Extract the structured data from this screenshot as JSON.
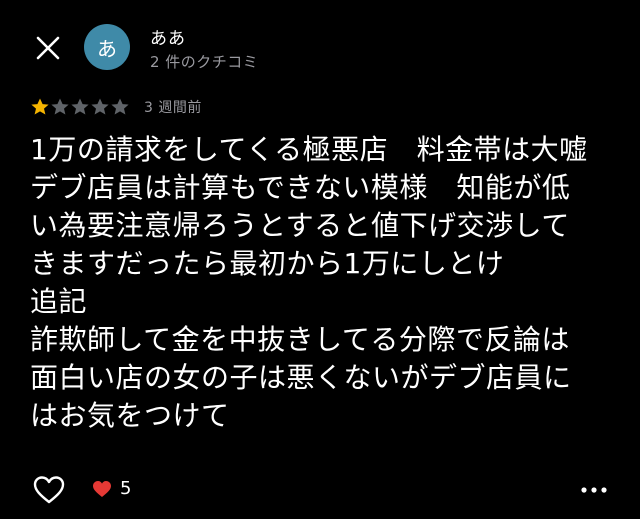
{
  "author": {
    "name": "ああ",
    "avatar_initial": "あ",
    "meta": "2 件のクチコミ",
    "avatar_color": "#3f8aa8"
  },
  "rating": {
    "value": 1,
    "max": 5,
    "star_color": "#f5b400",
    "empty_star_color": "#5f6368",
    "time": "3 週間前"
  },
  "review": {
    "text": "1万の請求をしてくる極悪店　料金帯は大嘘\nデブ店員は計算もできない模様　知能が低\nい為要注意帰ろうとすると値下げ交渉して\nきますだったら最初から1万にしとけ\n追記\n詐欺師して金を中抜きしてる分際で反論は\n面白い店の女の子は悪くないがデブ店員に\nはお気をつけて"
  },
  "footer": {
    "reaction_count": "5",
    "reaction_color": "#e53935"
  },
  "icons": {
    "close": "close-icon",
    "like": "heart-outline-icon",
    "reaction": "heart-filled-icon",
    "more": "more-horizontal-icon"
  }
}
